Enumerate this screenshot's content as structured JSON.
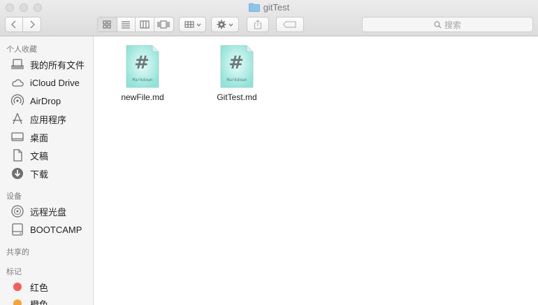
{
  "window": {
    "title": "gitTest"
  },
  "toolbar": {
    "search_placeholder": "搜索"
  },
  "sidebar": {
    "sections": [
      {
        "label": "个人收藏",
        "items": [
          {
            "label": "我的所有文件",
            "icon": "all-files-icon"
          },
          {
            "label": "iCloud Drive",
            "icon": "cloud-icon"
          },
          {
            "label": "AirDrop",
            "icon": "airdrop-icon"
          },
          {
            "label": "应用程序",
            "icon": "applications-icon"
          },
          {
            "label": "桌面",
            "icon": "desktop-icon"
          },
          {
            "label": "文稿",
            "icon": "documents-icon"
          },
          {
            "label": "下载",
            "icon": "downloads-icon"
          }
        ]
      },
      {
        "label": "设备",
        "items": [
          {
            "label": "远程光盘",
            "icon": "remote-disc-icon"
          },
          {
            "label": "BOOTCAMP",
            "icon": "drive-icon"
          }
        ]
      },
      {
        "label": "共享的",
        "items": []
      },
      {
        "label": "标记",
        "items": [
          {
            "label": "红色",
            "color": "#f25e5c"
          },
          {
            "label": "橙色",
            "color": "#f5a23b"
          }
        ]
      }
    ]
  },
  "files": [
    {
      "name": "newFile.md",
      "badge": "Markdown",
      "glyph": "#"
    },
    {
      "name": "GitTest.md",
      "badge": "Markdown",
      "glyph": "#"
    }
  ]
}
